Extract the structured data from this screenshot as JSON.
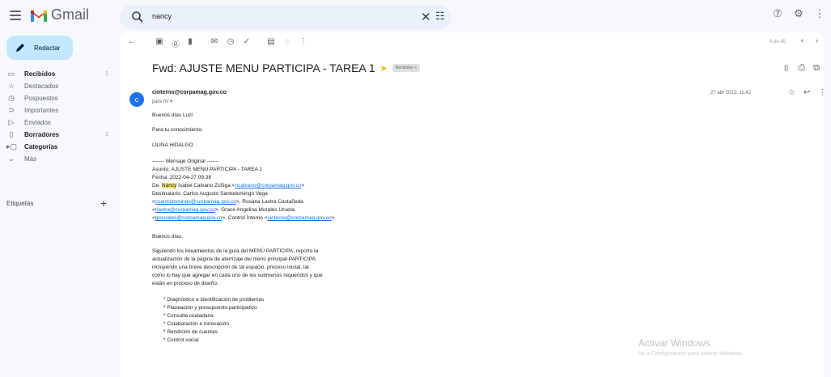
{
  "app": {
    "brand": "Gmail"
  },
  "search": {
    "query": "nancy"
  },
  "sidebar": {
    "compose_label": "Redactar",
    "items": [
      {
        "label": "Recibidos",
        "icon": "inbox-icon",
        "count": "1",
        "bold": true
      },
      {
        "label": "Destacados",
        "icon": "star-icon",
        "count": "",
        "bold": false
      },
      {
        "label": "Pospuestos",
        "icon": "clock-icon",
        "count": "",
        "bold": false
      },
      {
        "label": "Importantes",
        "icon": "important-icon",
        "count": "",
        "bold": false
      },
      {
        "label": "Enviados",
        "icon": "send-icon",
        "count": "",
        "bold": false
      },
      {
        "label": "Borradores",
        "icon": "draft-icon",
        "count": "1",
        "bold": true
      },
      {
        "label": "Categorías",
        "icon": "label-icon",
        "count": "",
        "bold": true
      },
      {
        "label": "Más",
        "icon": "chevron-down-icon",
        "count": "",
        "bold": false
      }
    ],
    "labels_title": "Etiquetas"
  },
  "pager": {
    "text": "4 de 45"
  },
  "email": {
    "subject": "Fwd: AJUSTE MENU PARTICIPA - TAREA 1",
    "label_chip": "Recibidos ×",
    "avatar_letter": "c",
    "sender": "cinterno@corpamag.gov.co",
    "to": "para mí ▾",
    "date": "27 abr 2022, 11:42",
    "body": {
      "greeting": "Buenos días Luzl",
      "line2": "Para tu conocimiento.",
      "signature": "LILINA HIDALGO",
      "fwd_header": "------- Mensaje Original -------",
      "asunto": "Asunto: AJUSTE MENU PARTICIPA - TAREA 1",
      "fecha": "Fecha: 2022-04-27 09:38",
      "de_prefix": "De: ",
      "de_highlight": "Nancy",
      "de_rest": " Isabel Calvano Zúñiga <",
      "de_email": "ncalvano@corpamag.gov.co",
      "de_close": ">",
      "dest_line1": "Destinatario: Carlos Augusto Santodomingo Vega",
      "dest_l2_email": "csantodomingo@corpamag.gov.co",
      "dest_l2_rest": ">, Rosana Lastra Castañeda",
      "dest_l3_email": "rlastra@corpamag.gov.co",
      "dest_l3_rest": ">, Grace Angelina Morales Urueta",
      "dest_l4_email": "gmorales@corpamag.gov.co",
      "dest_l4_mid": ">, Control Interno <",
      "dest_l4_email2": "cinterno@corpamag.gov.co",
      "dest_l4_close": ">",
      "greeting2": "Buenos días,",
      "para1": "Siguiendo los lineamientos de la guía del MENÚ PARTICIPA, reporto la",
      "para2": "actualización de la página de aterrizaje del menú principal PARTICIPA",
      "para3": "incluyendo una breve descripción de tal espacio, proceso inicial, tal",
      "para4": "como lo hay que agregar en cada uno de los submenús requeridos y que",
      "para5": "están en proceso de diseño:",
      "bullets": [
        "* Diagnóstico e identificación de problemas",
        "* Planeación y presupuesto participativo",
        "* Consulta ciudadana",
        "* Colaboración e innovación",
        "* Rendición de cuentas",
        "* Control social"
      ]
    }
  },
  "watermark": {
    "title": "Activar Windows",
    "subtitle": "Ve a Configuración para activar Windows."
  }
}
